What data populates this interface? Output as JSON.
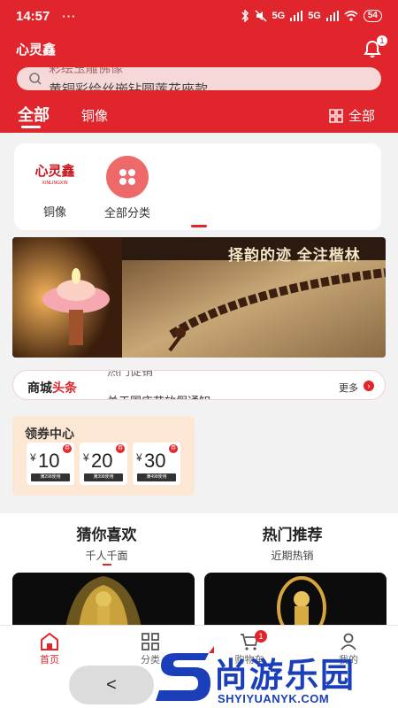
{
  "status_bar": {
    "time": "14:57",
    "dots": "···",
    "signal_1": "5G",
    "signal_2": "5G",
    "battery": "54"
  },
  "header": {
    "brand": "心灵鑫",
    "notification_count": "1"
  },
  "search": {
    "prev_text": "彩绘玉雕佛像",
    "text": "黄铜彩绘丝嵌钻圆莲花座款"
  },
  "tabs": {
    "all": "全部",
    "copper": "铜像",
    "right_all": "全部"
  },
  "categories": [
    {
      "label": "铜像",
      "logo_text": "心灵鑫",
      "logo_sub": "XINLINGXIN"
    },
    {
      "label": "全部分类"
    }
  ],
  "banner": {
    "caption": "择韵的迹 全注楷林"
  },
  "news": {
    "label_a": "商城",
    "label_b": "头条",
    "prev_text": "热门促销",
    "text": "关于国庆节放假通知",
    "more": "更多"
  },
  "coupons": {
    "title": "领券中心",
    "items": [
      {
        "yen": "¥",
        "amount": "10",
        "condition": "满298使用"
      },
      {
        "yen": "¥",
        "amount": "20",
        "condition": "满398使用"
      },
      {
        "yen": "¥",
        "amount": "30",
        "condition": "满498使用"
      }
    ]
  },
  "recommend": {
    "left": {
      "title": "猜你喜欢",
      "sub": "千人千面"
    },
    "right": {
      "title": "热门推荐",
      "sub": "近期热销"
    }
  },
  "tabbar": {
    "items": [
      {
        "label": "首页"
      },
      {
        "label": "分类"
      },
      {
        "label": "购物车",
        "badge": "1"
      },
      {
        "label": "我的"
      }
    ]
  },
  "nav": {
    "back": "<"
  },
  "watermark": {
    "main": "尚游乐园",
    "sub": "SHYIYUANYK.COM"
  },
  "colors": {
    "brand_red": "#e0262c",
    "coupon_bg": "#fce7d5",
    "watermark_blue": "#1a3fb8"
  }
}
